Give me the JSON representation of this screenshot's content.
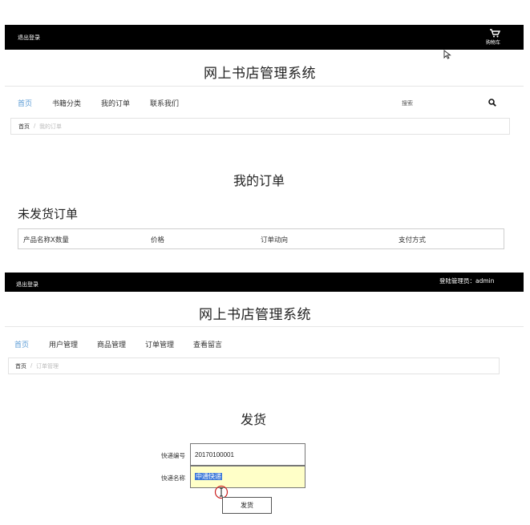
{
  "front": {
    "logout": "退出登录",
    "cart_label": "购物车",
    "site_title": "网上书店管理系统",
    "nav": [
      "首页",
      "书籍分类",
      "我的订单",
      "联系我们"
    ],
    "search_placeholder": "搜索",
    "breadcrumb": {
      "home": "首页",
      "sep": "/",
      "current": "我的订单"
    },
    "page_heading": "我的订单",
    "section_heading": "未发货订单",
    "table_headers": [
      "产品名称X数量",
      "价格",
      "订单动向",
      "支付方式"
    ]
  },
  "admin": {
    "logout": "退出登录",
    "user_info": "登陆管理员：admin",
    "site_title": "网上书店管理系统",
    "nav": [
      "首页",
      "用户管理",
      "商品管理",
      "订单管理",
      "查看留言"
    ],
    "breadcrumb": {
      "home": "首页",
      "sep": "/",
      "current": "订单管理"
    },
    "form_heading": "发货",
    "tracking_label": "快递编号",
    "tracking_value": "20170100001",
    "courier_label": "快递名称",
    "courier_value": "中通快递",
    "ship_button": "发货"
  },
  "colors": {
    "topbar": "#000000",
    "nav_active": "#5b9bd5",
    "field_highlight": "#ffffc8",
    "selection": "#3c78d8"
  }
}
